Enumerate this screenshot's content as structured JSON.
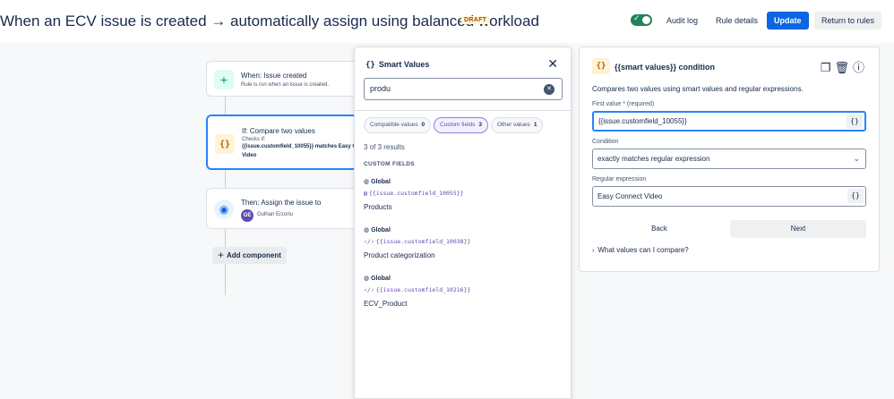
{
  "header": {
    "title": "When an ECV issue is created → automatically assign using balanced workload",
    "status_badge": "DRAFT",
    "toggle_on": true,
    "audit_log": "Audit log",
    "rule_details": "Rule details",
    "update": "Update",
    "return": "Return to rules"
  },
  "flow": {
    "trigger": {
      "title": "When: Issue created",
      "subtitle": "Rule is run when an issue is created."
    },
    "condition": {
      "title": "If: Compare two values",
      "checks": "Checks if:",
      "expr": "{{issue.customfield_10055}} matches Easy Connect",
      "expr2": "Video"
    },
    "action": {
      "title": "Then: Assign the issue to",
      "avatar_initials": "GE",
      "assignee": "Gulhan Erzorlu"
    },
    "add_component": "Add component"
  },
  "smart_values": {
    "title": "Smart Values",
    "search_value": "produ",
    "chips": [
      {
        "label": "Compatible values",
        "count": "0"
      },
      {
        "label": "Custom fields",
        "count": "3"
      },
      {
        "label": "Other values",
        "count": "1"
      }
    ],
    "results_text": "3 of 3 results",
    "section": "CUSTOM FIELDS",
    "items": [
      {
        "scope": "Global",
        "code": "{{issue.customfield_10055}}",
        "name": "Products"
      },
      {
        "scope": "Global",
        "code": "{{issue.customfield_10038}}",
        "name": "Product categorization"
      },
      {
        "scope": "Global",
        "code": "{{issue.customfield_10216}}",
        "name": "ECV_Product"
      }
    ]
  },
  "condition_panel": {
    "icon": "{}",
    "title": "{{smart values}} condition",
    "description": "Compares two values using smart values and regular expressions.",
    "first_value_label": "First value *",
    "first_value_required": "(required)",
    "first_value": "{{issue.customfield_10055}}",
    "condition_label": "Condition",
    "condition_value": "exactly matches regular expression",
    "regex_label": "Regular expression",
    "regex_value": "Easy Connect Video",
    "back": "Back",
    "next": "Next",
    "help": "What values can I compare?"
  },
  "colors": {
    "primary": "#0c66e4",
    "toggle": "#1f845a",
    "accent_purple": "#5e4db2"
  },
  "icons": [
    "toggle-check-icon",
    "plus-icon",
    "braces-icon",
    "user-icon",
    "close-icon",
    "clear-icon",
    "globe-icon",
    "field-icon",
    "copy-icon",
    "trash-icon",
    "help-icon",
    "chevron-down-icon",
    "chevron-right-icon"
  ]
}
